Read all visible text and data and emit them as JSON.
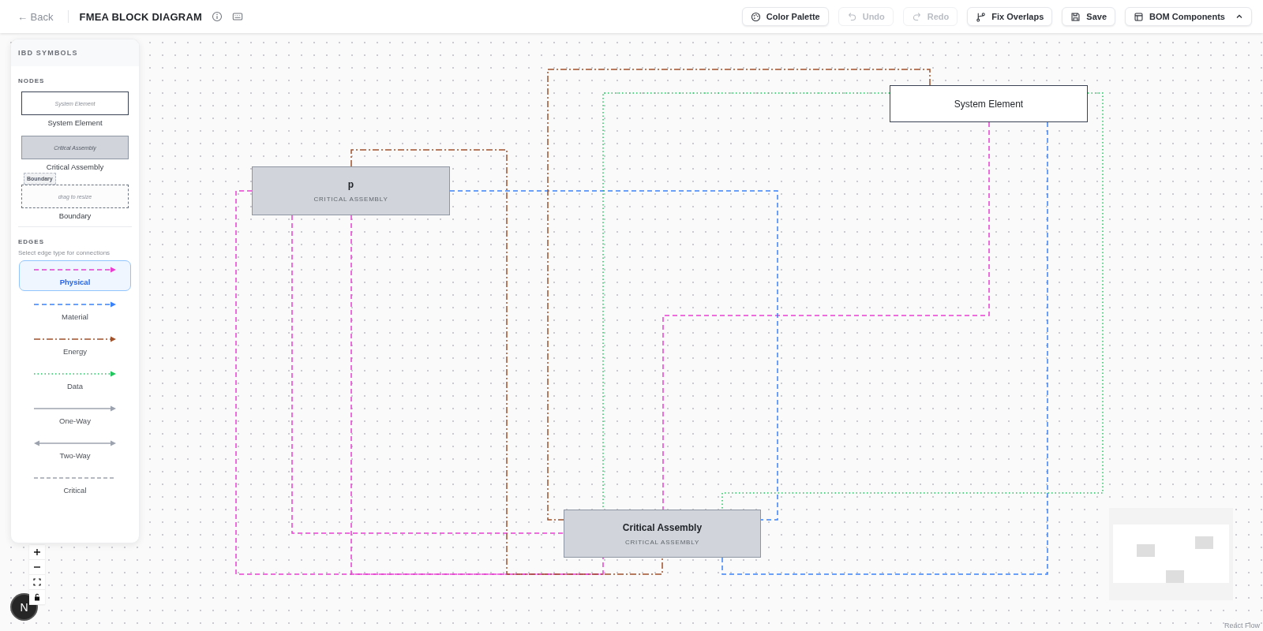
{
  "toolbar": {
    "back": "← Back",
    "title": "FMEA BLOCK DIAGRAM",
    "buttons": [
      {
        "kind": "palette",
        "label": "Color Palette",
        "disabled": false
      },
      {
        "kind": "undo",
        "label": "Undo",
        "disabled": true
      },
      {
        "kind": "redo",
        "label": "Redo",
        "disabled": true
      },
      {
        "kind": "fix",
        "label": "Fix Overlaps",
        "disabled": false
      },
      {
        "kind": "save",
        "label": "Save",
        "disabled": false
      },
      {
        "kind": "bom",
        "label": "BOM Components",
        "disabled": false
      }
    ]
  },
  "sidebar": {
    "title": "IBD SYMBOLS",
    "nodes_heading": "NODES",
    "nodes": [
      {
        "kind": "system",
        "preview": "System Element",
        "label": "System Element"
      },
      {
        "kind": "critical",
        "preview": "Critical Assembly",
        "label": "Critical Assembly"
      },
      {
        "kind": "boundary",
        "tag": "Boundary",
        "preview": "drag to resize",
        "label": "Boundary"
      }
    ],
    "edges_heading": "EDGES",
    "edges_hint": "Select edge type for connections",
    "edges": [
      {
        "kind": "physical",
        "label": "Physical",
        "selected": true
      },
      {
        "kind": "material",
        "label": "Material",
        "selected": false
      },
      {
        "kind": "energy",
        "label": "Energy",
        "selected": false
      },
      {
        "kind": "data",
        "label": "Data",
        "selected": false
      },
      {
        "kind": "oneway",
        "label": "One-Way",
        "selected": false
      },
      {
        "kind": "twoway",
        "label": "Two-Way",
        "selected": false
      },
      {
        "kind": "critical",
        "label": "Critical",
        "selected": false
      }
    ]
  },
  "diagram": {
    "nodes": [
      {
        "kind": "critical",
        "title": "p",
        "subtitle": "CRITICAL ASSEMBLY"
      },
      {
        "kind": "system",
        "title": "System Element"
      },
      {
        "kind": "critical",
        "title": "Critical Assembly",
        "subtitle": "CRITICAL ASSEMBLY"
      }
    ],
    "edges": [
      {
        "kind": "physical"
      },
      {
        "kind": "physical"
      },
      {
        "kind": "physical"
      },
      {
        "kind": "physical"
      },
      {
        "kind": "material"
      },
      {
        "kind": "material"
      },
      {
        "kind": "energy"
      },
      {
        "kind": "energy"
      },
      {
        "kind": "data"
      },
      {
        "kind": "data"
      }
    ]
  },
  "avatar": "N",
  "attribution": "React Flow"
}
